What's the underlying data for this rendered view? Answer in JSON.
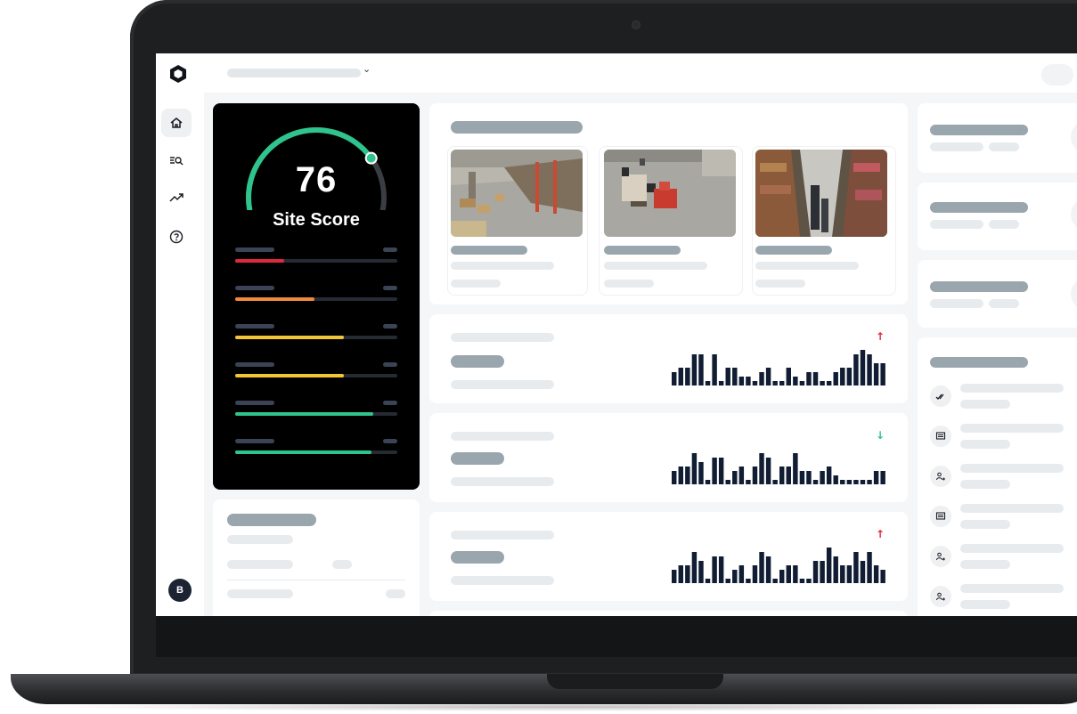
{
  "app": {
    "nav": [
      {
        "key": "home",
        "icon": "home-icon",
        "active": true
      },
      {
        "key": "search",
        "icon": "list-search-icon",
        "active": false
      },
      {
        "key": "trends",
        "icon": "trending-up-icon",
        "active": false
      },
      {
        "key": "help",
        "icon": "help-circle-icon",
        "active": false
      }
    ],
    "user_initial": "B"
  },
  "score": {
    "value": "76",
    "label": "Site Score",
    "gauge_fraction": 0.76,
    "gauge_color": "#2fc48d",
    "metrics": [
      {
        "fraction": 0.3,
        "color": "#e0283c"
      },
      {
        "fraction": 0.49,
        "color": "#f08a3a"
      },
      {
        "fraction": 0.67,
        "color": "#f2c535"
      },
      {
        "fraction": 0.67,
        "color": "#f2c535"
      },
      {
        "fraction": 0.85,
        "color": "#2fc48d"
      },
      {
        "fraction": 0.84,
        "color": "#2fc48d"
      }
    ]
  },
  "camera_feeds": [
    {
      "icon": "camera-feed-image",
      "scene": "warehouse-aisle"
    },
    {
      "icon": "camera-feed-image",
      "scene": "forklift-floor"
    },
    {
      "icon": "camera-feed-image",
      "scene": "warehouse-racks"
    }
  ],
  "trends": [
    {
      "direction": "up",
      "arrow": "↑",
      "color": "#e0283c",
      "bars": [
        3,
        4,
        4,
        7,
        7,
        1,
        7,
        1,
        4,
        4,
        2,
        2,
        1,
        3,
        4,
        1,
        1,
        4,
        2,
        1,
        3,
        3,
        1,
        1,
        3,
        4,
        4,
        7,
        8,
        7,
        5,
        5
      ]
    },
    {
      "direction": "down",
      "arrow": "↓",
      "color": "#2fc48d",
      "bars": [
        3,
        4,
        4,
        7,
        5,
        1,
        6,
        6,
        1,
        3,
        4,
        1,
        4,
        7,
        6,
        1,
        4,
        4,
        7,
        3,
        3,
        1,
        3,
        4,
        2,
        1,
        1,
        1,
        1,
        1,
        3,
        3
      ]
    },
    {
      "direction": "up",
      "arrow": "↑",
      "color": "#e0283c",
      "bars": [
        3,
        4,
        4,
        7,
        5,
        1,
        6,
        6,
        1,
        3,
        4,
        1,
        4,
        7,
        6,
        1,
        3,
        4,
        4,
        1,
        1,
        5,
        5,
        8,
        6,
        4,
        4,
        7,
        5,
        7,
        4,
        3
      ]
    }
  ],
  "right_panel": {
    "controls": [
      {
        "glyph": "‹",
        "icon": "chevron-left-icon"
      },
      {
        "glyph": "⌄",
        "icon": "chevron-down-icon"
      },
      {
        "glyph": "▌",
        "icon": "panel-icon"
      }
    ],
    "activity": [
      {
        "icon": "double-check-icon"
      },
      {
        "icon": "message-icon"
      },
      {
        "icon": "user-group-icon"
      },
      {
        "icon": "message-icon"
      },
      {
        "icon": "user-group-icon"
      },
      {
        "icon": "user-group-icon"
      }
    ]
  },
  "colors": {
    "bar": "#101d33",
    "skeleton_dark": "#9aa6ae",
    "skeleton_light": "#e6eaed"
  }
}
